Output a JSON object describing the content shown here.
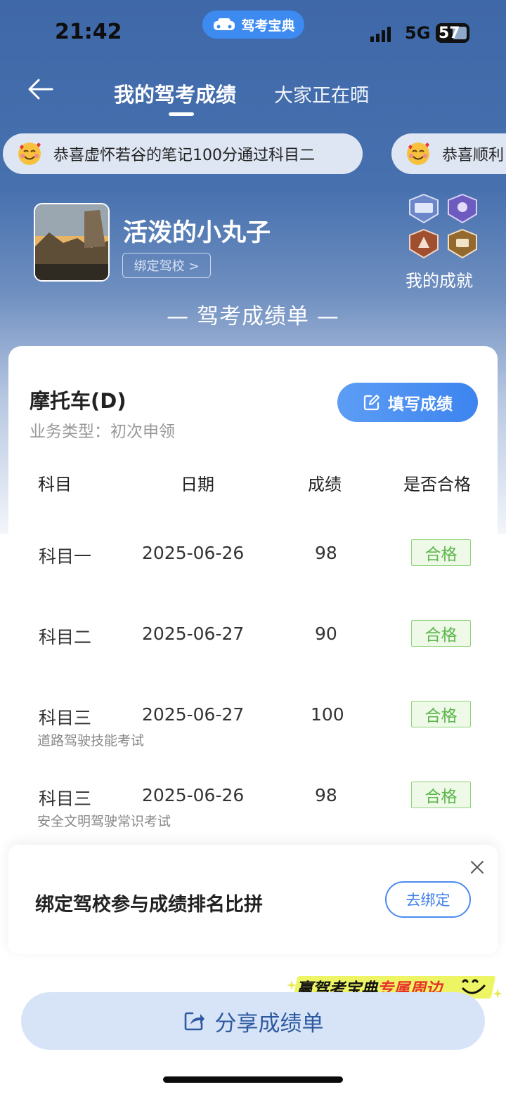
{
  "status_bar": {
    "time": "21:42",
    "app_name": "驾考宝典",
    "network": "5G",
    "battery": "57"
  },
  "nav": {
    "active_tab": "我的驾考成绩",
    "other_tab": "大家正在晒"
  },
  "marquee": [
    "恭喜虚怀若谷的笔记100分通过科目二",
    "恭喜顺利"
  ],
  "profile": {
    "name": "活泼的小丸子",
    "bind_school": "绑定驾校 >",
    "achievements_label": "我的成就"
  },
  "report_title": "— 驾考成绩单 —",
  "card": {
    "vehicle": "摩托车(D)",
    "business_type": "业务类型：初次申领",
    "fill_button": "填写成绩",
    "headers": [
      "科目",
      "日期",
      "成绩",
      "是否合格"
    ],
    "rows": [
      {
        "subject": "科目一",
        "sub": "",
        "date": "2025-06-26",
        "score": "98",
        "result": "合格"
      },
      {
        "subject": "科目二",
        "sub": "",
        "date": "2025-06-27",
        "score": "90",
        "result": "合格"
      },
      {
        "subject": "科目三",
        "sub": "道路驾驶技能考试",
        "date": "2025-06-27",
        "score": "100",
        "result": "合格"
      },
      {
        "subject": "科目三",
        "sub": "安全文明驾驶常识考试",
        "date": "2025-06-26",
        "score": "98",
        "result": "合格"
      }
    ]
  },
  "bind_bar": {
    "text": "绑定驾校参与成绩排名比拼",
    "button": "去绑定"
  },
  "promo": {
    "part1": "赢驾考宝典",
    "part2": "专属周边"
  },
  "share_button": "分享成绩单",
  "colors": {
    "header_blue": "#4670ae",
    "primary_blue": "#3c84ef",
    "pass_green": "#5cb64b"
  }
}
